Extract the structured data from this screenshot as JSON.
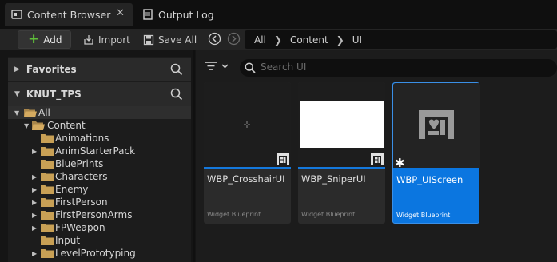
{
  "tabs": [
    {
      "label": "Content Browser",
      "icon": "content-browser-icon"
    },
    {
      "label": "Output Log",
      "icon": "output-log-icon"
    }
  ],
  "toolbar": {
    "add_label": "Add",
    "import_label": "Import",
    "save_all_label": "Save All"
  },
  "breadcrumb": [
    "All",
    "Content",
    "UI"
  ],
  "sidebar": {
    "favorites_label": "Favorites",
    "project_label": "KNUT_TPS",
    "tree": [
      {
        "label": "All",
        "expanded": true,
        "selected": true
      },
      {
        "label": "Content",
        "expanded": true
      },
      {
        "label": "Animations"
      },
      {
        "label": "AnimStarterPack"
      },
      {
        "label": "BluePrints"
      },
      {
        "label": "Characters"
      },
      {
        "label": "Enemy"
      },
      {
        "label": "FirstPerson"
      },
      {
        "label": "FirstPersonArms"
      },
      {
        "label": "FPWeapon"
      },
      {
        "label": "Input"
      },
      {
        "label": "LevelPrototyping"
      }
    ]
  },
  "search": {
    "placeholder": "Search UI"
  },
  "assets": [
    {
      "name": "WBP_CrosshairUI",
      "type": "Widget Blueprint",
      "selected": false
    },
    {
      "name": "WBP_SniperUI",
      "type": "Widget Blueprint",
      "selected": false
    },
    {
      "name": "WBP_UIScreen",
      "type": "Widget Blueprint",
      "selected": true
    }
  ],
  "colors": {
    "accent": "#0b76e0",
    "add_icon": "#5fbf3a",
    "folder": "#c8a055"
  }
}
